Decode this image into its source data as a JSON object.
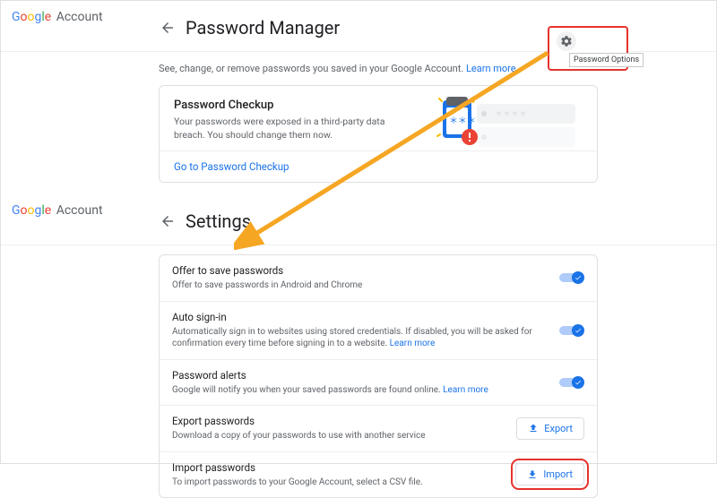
{
  "brand": {
    "google": "Google",
    "account": "Account"
  },
  "pm": {
    "title": "Password Manager",
    "subtext": "See, change, or remove passwords you saved in your Google Account.",
    "learn_more": "Learn more",
    "gear_tooltip": "Password Options",
    "checkup": {
      "title": "Password Checkup",
      "desc": "Your passwords were exposed in a third-party data breach. You should change them now.",
      "action": "Go to Password Checkup"
    }
  },
  "settings": {
    "title": "Settings",
    "rows": {
      "save": {
        "title": "Offer to save passwords",
        "desc": "Offer to save passwords in Android and Chrome"
      },
      "auto": {
        "title": "Auto sign-in",
        "desc": "Automatically sign in to websites using stored credentials. If disabled, you will be asked for confirmation every time before signing in to a website.",
        "learn": "Learn more"
      },
      "alerts": {
        "title": "Password alerts",
        "desc": "Google will notify you when your saved passwords are found online.",
        "learn": "Learn more"
      },
      "export": {
        "title": "Export passwords",
        "desc": "Download a copy of your passwords to use with another service",
        "btn": "Export"
      },
      "import": {
        "title": "Import passwords",
        "desc": "To import passwords to your Google Account, select a CSV file.",
        "btn": "Import"
      }
    }
  }
}
